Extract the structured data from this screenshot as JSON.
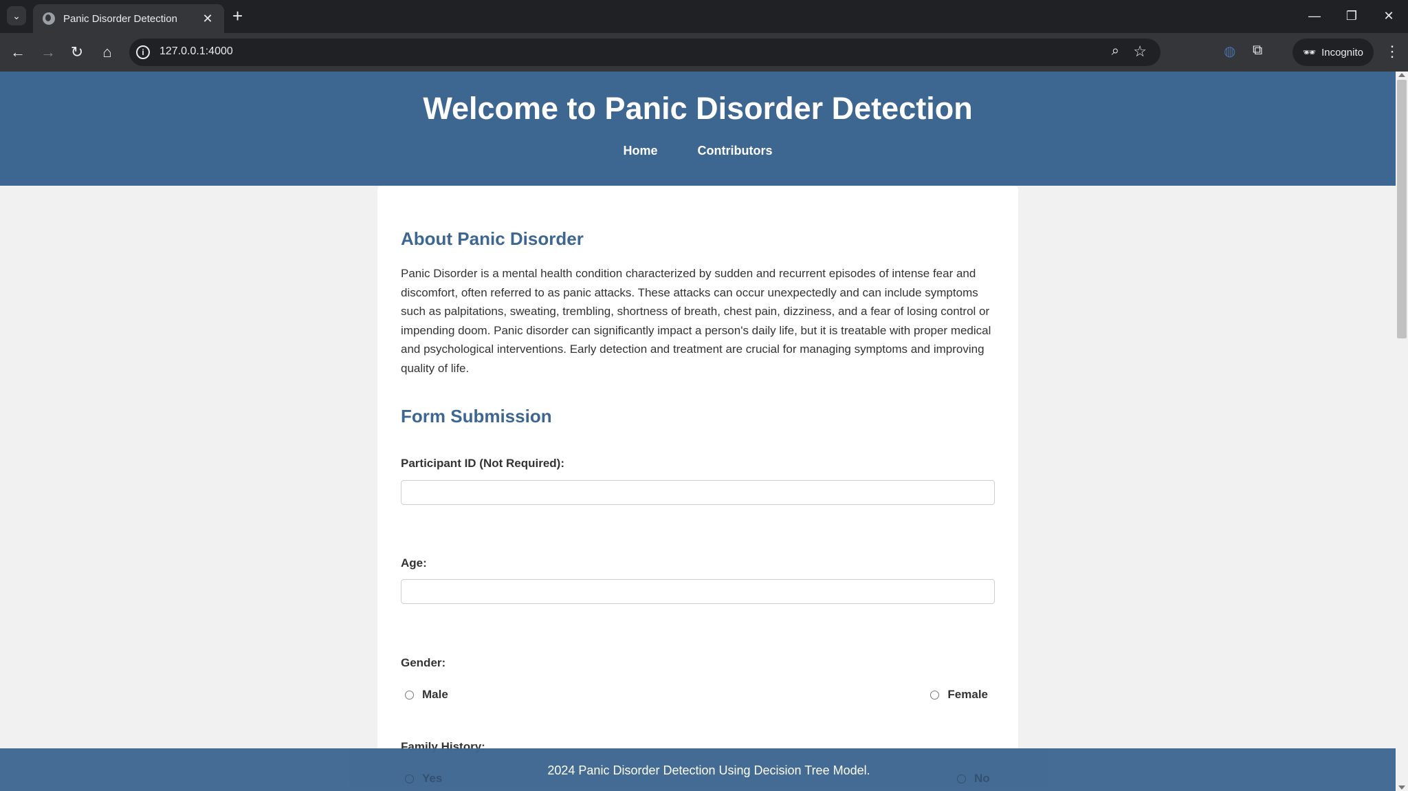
{
  "browser": {
    "tab_title": "Panic Disorder Detection",
    "url": "127.0.0.1:4000",
    "profile_label": "Incognito"
  },
  "header": {
    "title": "Welcome to Panic Disorder Detection",
    "nav": [
      "Home",
      "Contributors"
    ]
  },
  "about": {
    "heading": "About Panic Disorder",
    "body": "Panic Disorder is a mental health condition characterized by sudden and recurrent episodes of intense fear and discomfort, often referred to as panic attacks. These attacks can occur unexpectedly and can include symptoms such as palpitations, sweating, trembling, shortness of breath, chest pain, dizziness, and a fear of losing control or impending doom. Panic disorder can significantly impact a person's daily life, but it is treatable with proper medical and psychological interventions. Early detection and treatment are crucial for managing symptoms and improving quality of life."
  },
  "form": {
    "heading": "Form Submission",
    "participant_label": "Participant ID (Not Required):",
    "participant_value": "",
    "age_label": "Age:",
    "age_value": "",
    "gender_label": "Gender:",
    "gender_options": [
      "Male",
      "Female"
    ],
    "family_history_label": "Family History:",
    "family_history_options": [
      "Yes",
      "No"
    ]
  },
  "footer": {
    "text": "2024 Panic Disorder Detection Using Decision Tree Model."
  },
  "colors": {
    "header_bg": "#3d6690",
    "heading": "#3d6690",
    "page_bg": "#f1f1f1"
  }
}
